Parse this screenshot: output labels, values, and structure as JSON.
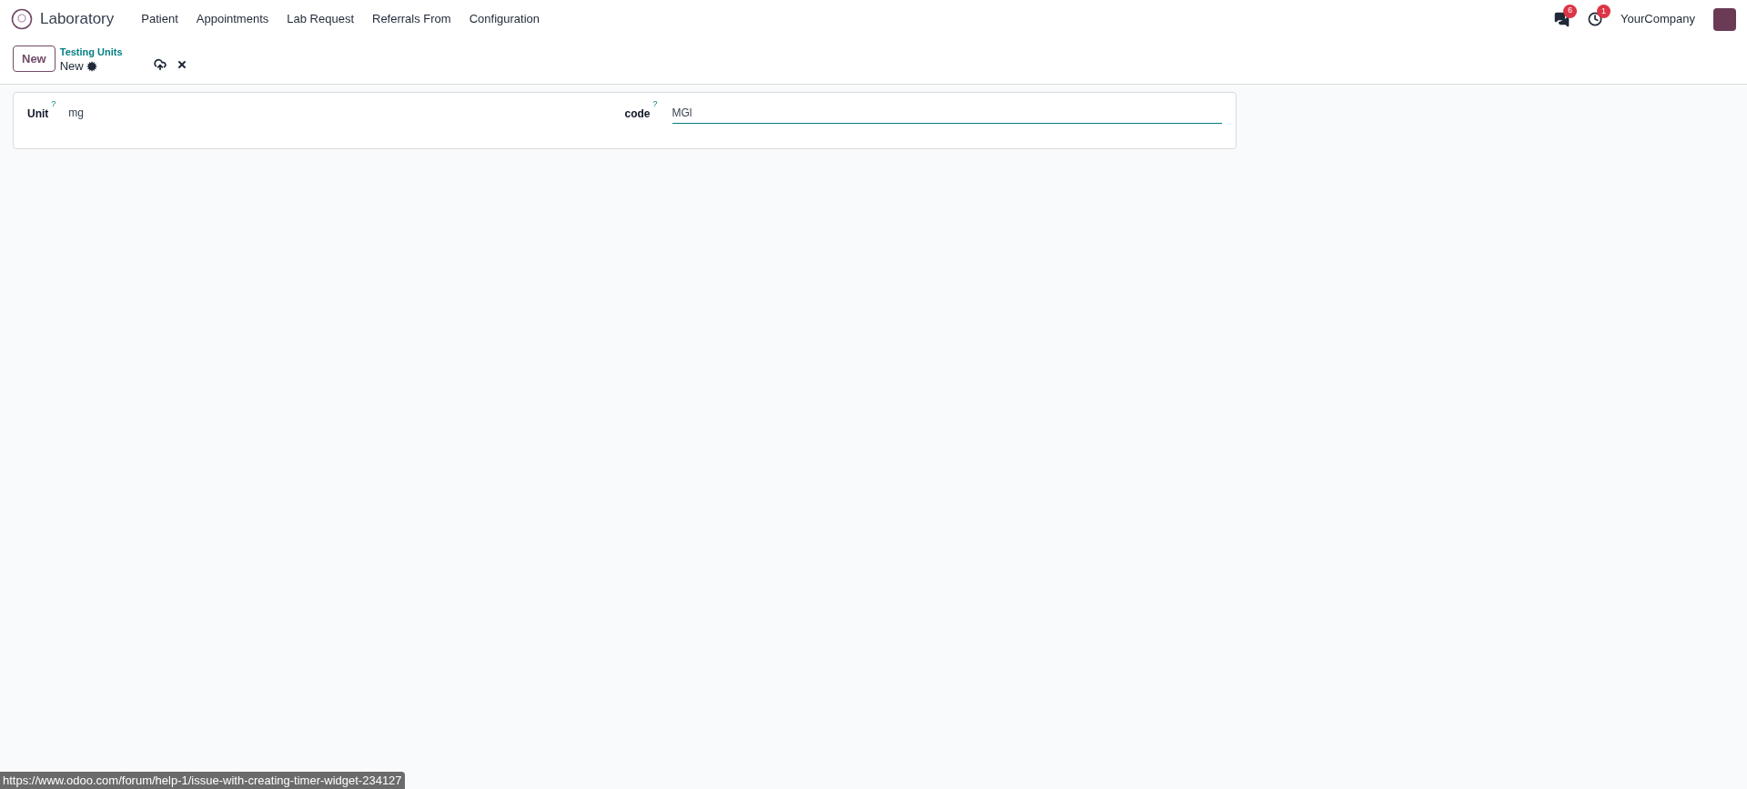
{
  "navbar": {
    "app_name": "Laboratory",
    "menu": [
      "Patient",
      "Appointments",
      "Lab Request",
      "Referrals From",
      "Configuration"
    ],
    "messages_badge": "6",
    "activities_badge": "1",
    "company": "YourCompany"
  },
  "control_panel": {
    "new_button": "New",
    "breadcrumb": "Testing Units",
    "record_name": "New"
  },
  "form": {
    "fields": [
      {
        "label": "Unit",
        "help": "?",
        "value": "mg",
        "focused": false
      },
      {
        "label": "code",
        "help": "?",
        "value": "MGl",
        "focused": true
      }
    ]
  },
  "status_url": "https://www.odoo.com/forum/help-1/issue-with-creating-timer-widget-234127"
}
